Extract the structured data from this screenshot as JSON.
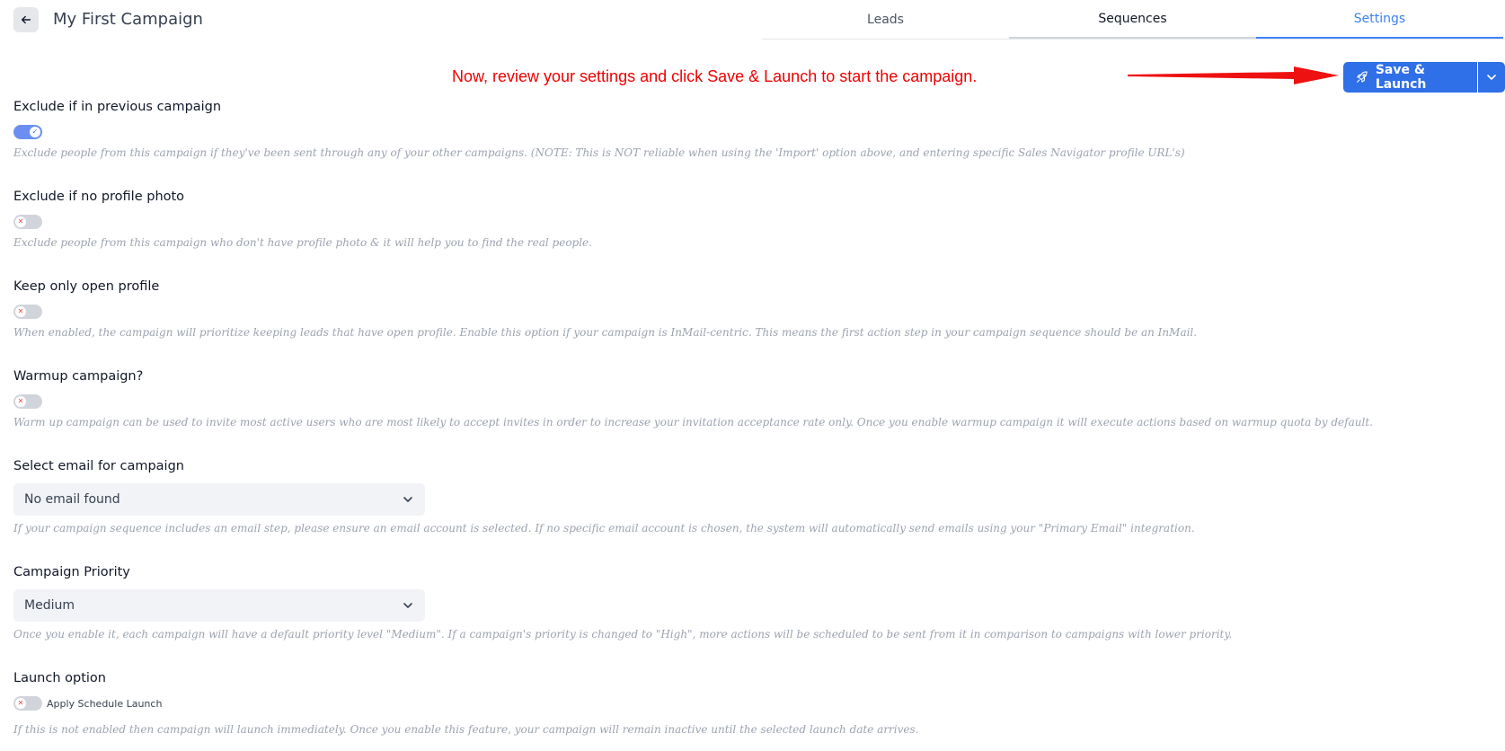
{
  "header": {
    "title": "My First Campaign",
    "tabs": [
      {
        "label": "Leads"
      },
      {
        "label": "Sequences"
      },
      {
        "label": "Settings"
      }
    ]
  },
  "annotation": {
    "text": "Now, review your settings and click Save & Launch to start the campaign.",
    "color": "#ef0000"
  },
  "actions": {
    "save_launch_label": "Save & Launch",
    "accent": "#2f6fe8"
  },
  "settings": {
    "exclude_previous": {
      "title": "Exclude if in previous campaign",
      "enabled": true,
      "description": "Exclude people from this campaign if they've been sent through any of your other campaigns. (NOTE: This is NOT reliable when using the 'Import' option above, and entering specific Sales Navigator profile URL's)"
    },
    "exclude_no_photo": {
      "title": "Exclude if no profile photo",
      "enabled": false,
      "description": "Exclude people from this campaign who don't have profile photo & it will help you to find the real people."
    },
    "open_profile": {
      "title": "Keep only open profile",
      "enabled": false,
      "description": "When enabled, the campaign will prioritize keeping leads that have open profile. Enable this option if your campaign is InMail-centric. This means the first action step in your campaign sequence should be an InMail."
    },
    "warmup": {
      "title": "Warmup campaign?",
      "enabled": false,
      "description": "Warm up campaign can be used to invite most active users who are most likely to accept invites in order to increase your invitation acceptance rate only. Once you enable warmup campaign it will execute actions based on warmup quota by default."
    },
    "email": {
      "title": "Select email for campaign",
      "selected": "No email found",
      "description": "If your campaign sequence includes an email step, please ensure an email account is selected. If no specific email account is chosen, the system will automatically send emails using your \"Primary Email\" integration."
    },
    "priority": {
      "title": "Campaign Priority",
      "selected": "Medium",
      "description": "Once you enable it, each campaign will have a default priority level \"Medium\". If a campaign's priority is changed to \"High\", more actions will be scheduled to be sent from it in comparison to campaigns with lower priority."
    },
    "launch": {
      "title": "Launch option",
      "toggle_label": "Apply Schedule Launch",
      "enabled": false,
      "description": "If this is not enabled then campaign will launch immediately. Once you enable this feature, your campaign will remain inactive until the selected launch date arrives."
    }
  }
}
